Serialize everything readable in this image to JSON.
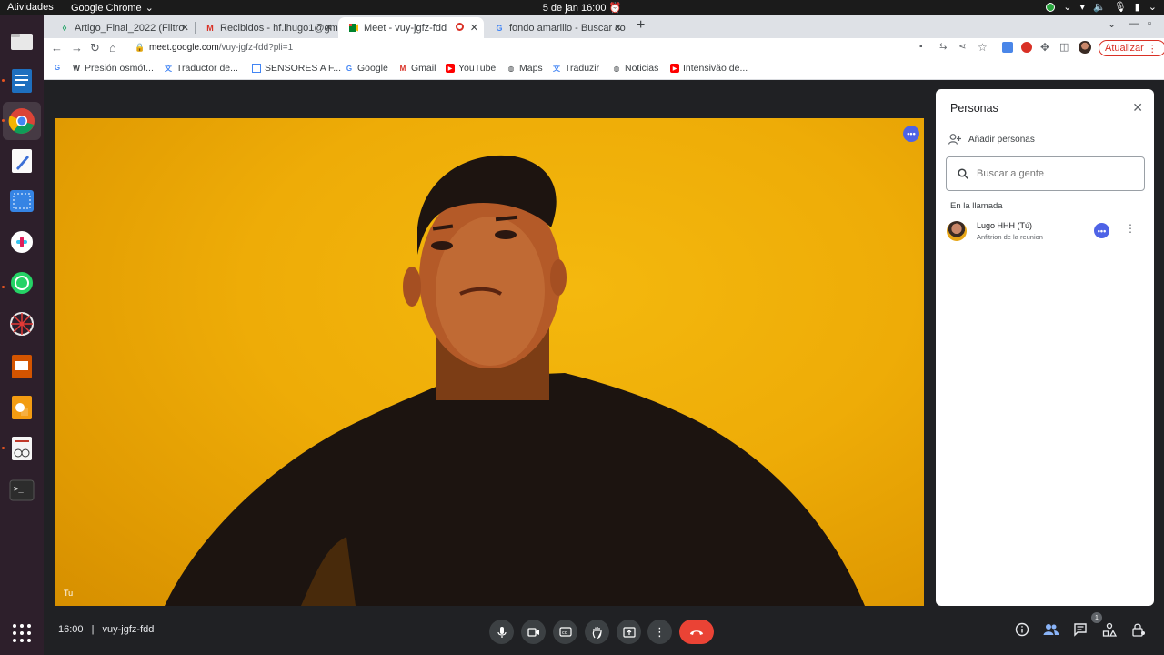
{
  "topbar": {
    "activities": "Atividades",
    "app_name": "Google Chrome",
    "clock": "5 de jan  16:00"
  },
  "tabs": [
    {
      "title": "Artigo_Final_2022 (Filtro",
      "icon": "sheets-icon"
    },
    {
      "title": "Recibidos - hf.lhugo1@gm",
      "icon": "gmail-icon"
    },
    {
      "title": "Meet - vuy-jgfz-fdd",
      "icon": "meet-icon",
      "active": true
    },
    {
      "title": "fondo amarillo - Buscar co",
      "icon": "google-icon"
    }
  ],
  "toolbar": {
    "url_host": "meet.google.com",
    "url_path": "/vuy-jgfz-fdd?pli=1",
    "update_label": "Atualizar"
  },
  "bookmarks": [
    {
      "label": "",
      "icon": "google-icon"
    },
    {
      "label": "Presión osmót...",
      "icon": "wikipedia-icon"
    },
    {
      "label": "Traductor de...",
      "icon": "translate-icon"
    },
    {
      "label": "SENSORES A F...",
      "icon": "doc-icon"
    },
    {
      "label": "Google",
      "icon": "google-icon"
    },
    {
      "label": "Gmail",
      "icon": "gmail-icon"
    },
    {
      "label": "YouTube",
      "icon": "youtube-icon"
    },
    {
      "label": "Maps",
      "icon": "globe-icon"
    },
    {
      "label": "Traduzir",
      "icon": "translate-icon"
    },
    {
      "label": "Noticias",
      "icon": "globe-icon"
    },
    {
      "label": "Intensivão de...",
      "icon": "youtube-icon"
    }
  ],
  "video": {
    "self_label": "Tu"
  },
  "people_panel": {
    "title": "Personas",
    "add_people": "Añadir personas",
    "search_placeholder": "Buscar a gente",
    "section_label": "En la llamada",
    "participants": [
      {
        "name": "Lugo HHH (Tú)",
        "role": "Anfitrion de la reunion"
      }
    ]
  },
  "bottombar": {
    "time": "16:00",
    "meeting_code": "vuy-jgfz-fdd",
    "participant_count": "1"
  },
  "colors": {
    "meet_bg": "#202124",
    "video_bg": "#eeac07",
    "hangup": "#ea4335",
    "accent": "#4e63e6"
  }
}
